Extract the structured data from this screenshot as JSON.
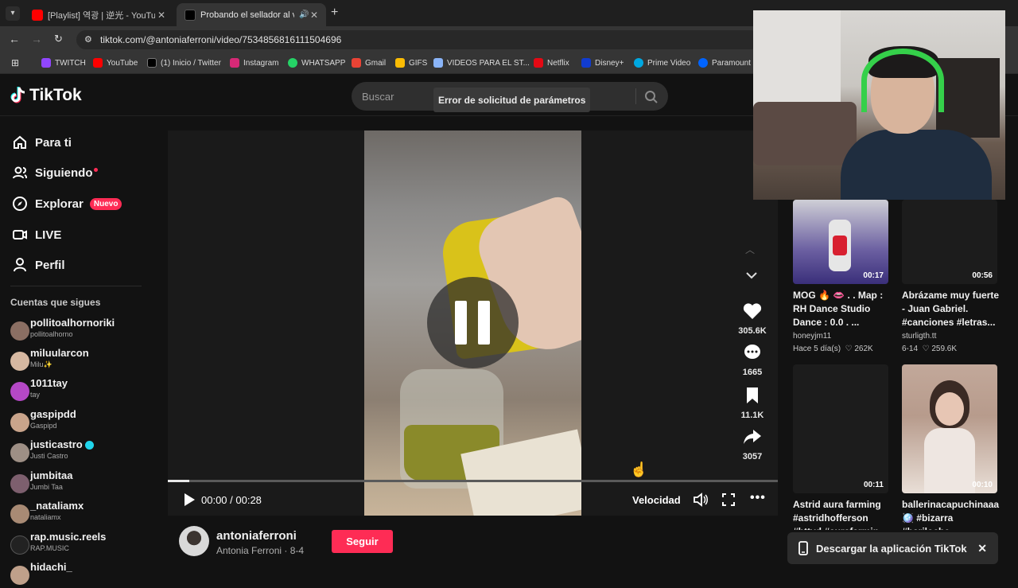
{
  "browser": {
    "tabs": [
      {
        "title": "[Playlist] 역광 | 逆光 - YouTube",
        "active": false
      },
      {
        "title": "Probando el sellador al vac",
        "active": true
      }
    ],
    "url": "tiktok.com/@antoniaferroni/video/7534856816111504696",
    "bookmarks": [
      "TWITCH",
      "YouTube",
      "(1) Inicio / Twitter",
      "Instagram",
      "WHATSAPP",
      "Gmail",
      "GIFS",
      "VIDEOS PARA EL ST...",
      "Netflix",
      "Disney+",
      "Prime Video",
      "Paramount"
    ]
  },
  "header": {
    "logo_text": "TikTok",
    "search_placeholder": "Buscar",
    "tooltip": "Error de solicitud de parámetros"
  },
  "sidebar": {
    "nav": [
      {
        "label": "Para ti",
        "icon": "home-icon"
      },
      {
        "label": "Siguiendo",
        "icon": "people-icon"
      },
      {
        "label": "Explorar",
        "icon": "compass-icon",
        "badge": "Nuevo"
      },
      {
        "label": "LIVE",
        "icon": "live-icon"
      },
      {
        "label": "Perfil",
        "icon": "person-icon"
      }
    ],
    "following_title": "Cuentas que sigues",
    "accounts": [
      {
        "username": "pollitoalhornoriki",
        "display": "pollitoalhorno"
      },
      {
        "username": "miluularcon",
        "display": "Milu✨"
      },
      {
        "username": "1011tay",
        "display": "tay"
      },
      {
        "username": "gaspipdd",
        "display": "Gaspipd"
      },
      {
        "username": "justicastro",
        "display": "Justi Castro",
        "verified": true
      },
      {
        "username": "jumbitaa",
        "display": "Jumbi Taa"
      },
      {
        "username": "_nataliamx",
        "display": "nataliamx"
      },
      {
        "username": "rap.music.reels",
        "display": "RAP.MUSIC"
      },
      {
        "username": "hidachi_",
        "display": ""
      }
    ]
  },
  "player": {
    "time": "00:00 / 00:28",
    "speed_label": "Velocidad",
    "progress": 0.035
  },
  "actions": {
    "likes": "305.6K",
    "comments": "1665",
    "saves": "11.1K",
    "shares": "3057"
  },
  "author": {
    "username": "antoniaferroni",
    "subline": "Antonia Ferroni · 8-4",
    "follow_label": "Seguir"
  },
  "recommendations": [
    {
      "duration": "00:17",
      "title": "MOG 🔥 👄 . . Map : RH Dance Studio Dance : 0.0 . ...",
      "author": "honeyjm11",
      "date": "Hace 5 día(s)",
      "likes": "262K"
    },
    {
      "duration": "00:56",
      "title": "Abrázame muy fuerte - Juan Gabriel. #canciones #letras...",
      "author": "sturligth.tt",
      "date": "6-14",
      "likes": "259.6K"
    },
    {
      "duration": "00:11",
      "title": "Astrid aura farming #astridhofferson #httyd #aurafarmin",
      "author": "",
      "date": "",
      "likes": ""
    },
    {
      "duration": "00:10",
      "title": "ballerinacapuchinaaa 🪩 #bizarra #bariloche",
      "author": "",
      "date": "",
      "likes": ""
    }
  ],
  "download_banner": "Descargar la aplicación TikTok",
  "colors": {
    "accent": "#fe2c55",
    "background": "#121212"
  }
}
